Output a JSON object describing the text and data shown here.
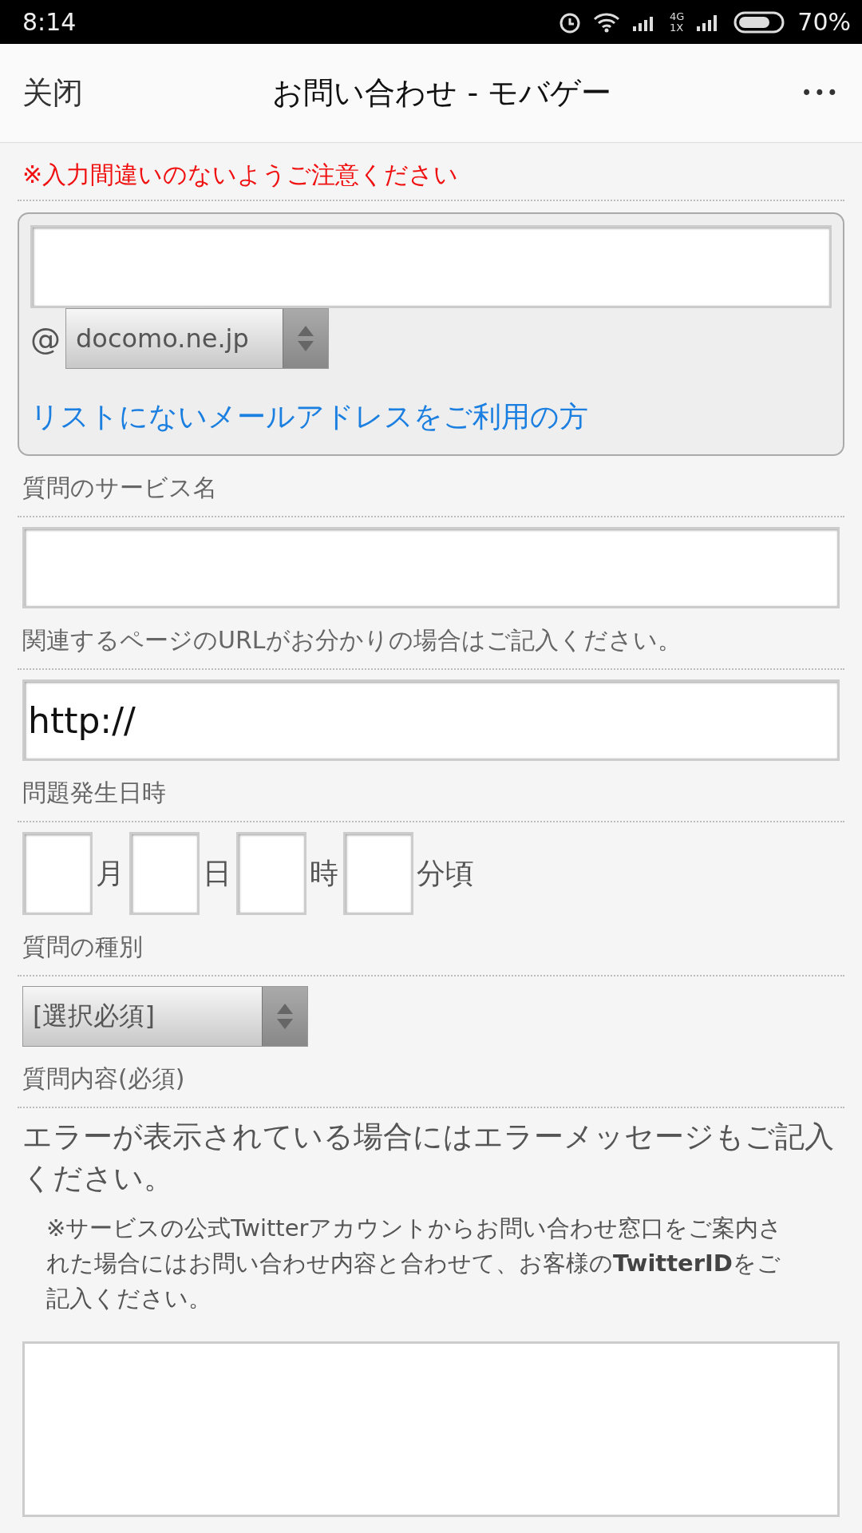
{
  "status_bar": {
    "time": "8:14",
    "network": "4G",
    "network_sub": "1X",
    "battery": "70%"
  },
  "header": {
    "close": "关闭",
    "title": "お問い合わせ - モバゲー",
    "menu": "•••"
  },
  "notice": "※入力間違いのないようご注意ください",
  "email": {
    "at": "@",
    "domain": "docomo.ne.jp",
    "other_link": "リストにないメールアドレスをご利用の方"
  },
  "service": {
    "label": "質問のサービス名"
  },
  "url": {
    "label": "関連するページのURLがお分かりの場合はご記入ください。",
    "value": "http://"
  },
  "datetime": {
    "label": "問題発生日時",
    "parts": [
      {
        "unit": "月"
      },
      {
        "unit": "日"
      },
      {
        "unit": "時"
      },
      {
        "unit": "分頃"
      }
    ]
  },
  "category": {
    "label": "質問の種別",
    "value": "[選択必須]"
  },
  "content": {
    "label": "質問内容(必須)",
    "instruction": "エラーが表示されている場合にはエラーメッセージもご記入ください。",
    "note": "※サービスの公式Twitterアカウントからお問い合わせ窓口をご案内された場合にはお問い合わせ内容と合わせて、お客様の**TwitterID**をご記入ください。"
  }
}
